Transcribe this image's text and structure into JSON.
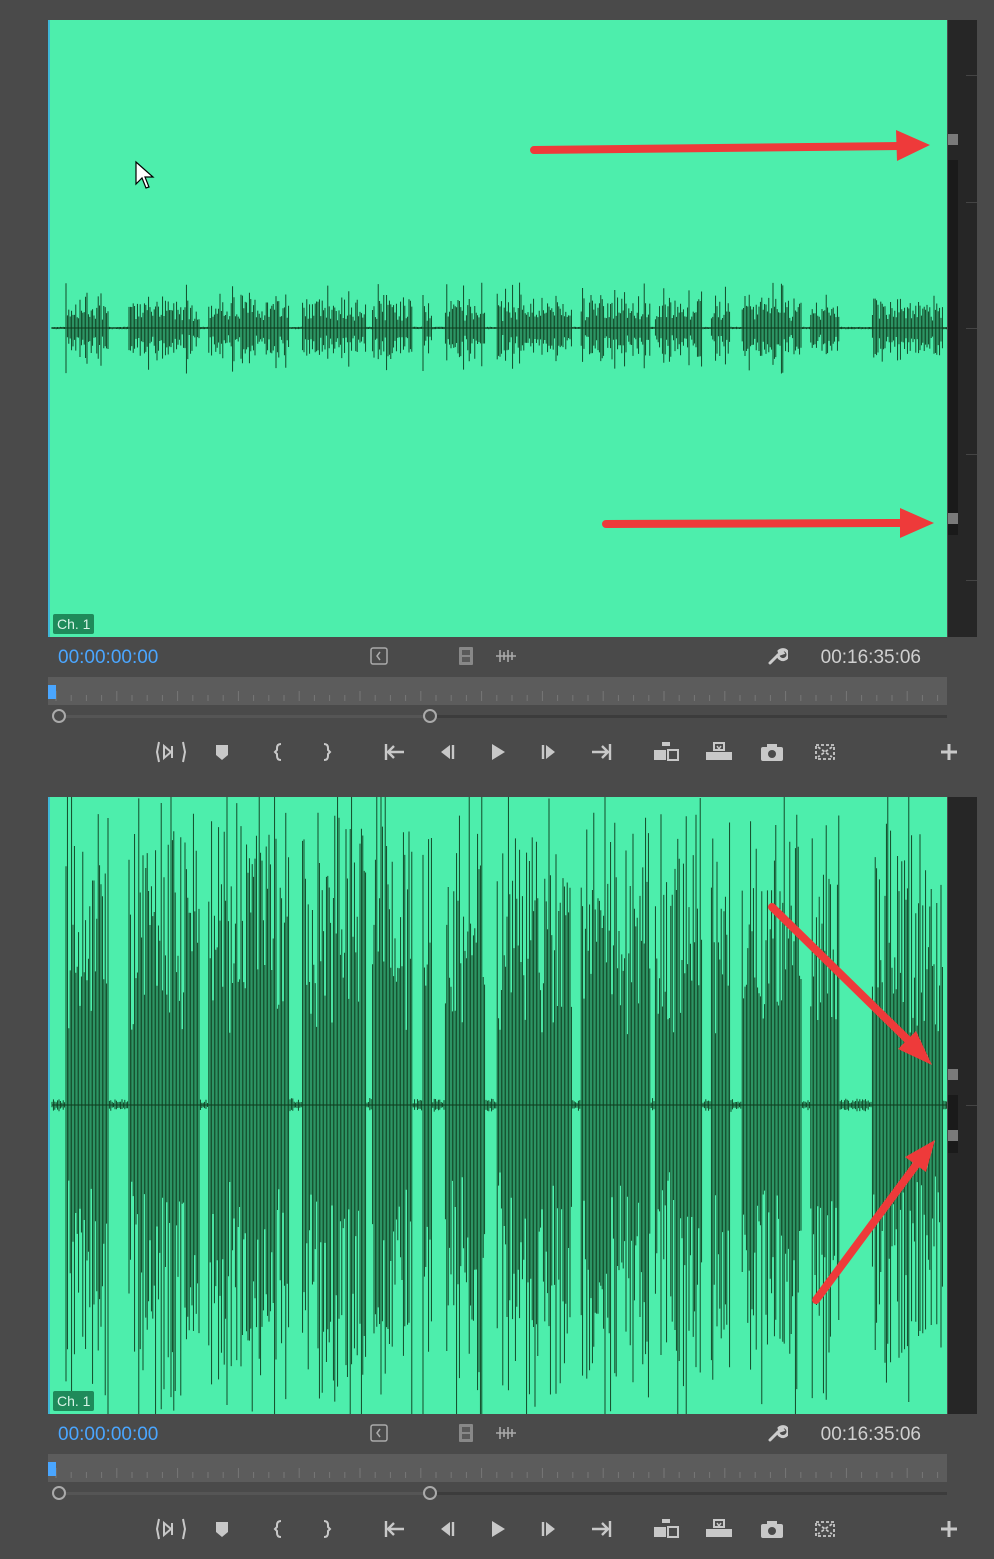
{
  "panels": [
    {
      "id": "top",
      "channel_label": "Ch. 1",
      "timecode_current": "00:00:00:00",
      "timecode_duration": "00:16:35:06"
    },
    {
      "id": "bottom",
      "channel_label": "Ch. 1",
      "timecode_current": "00:00:00:00",
      "timecode_duration": "00:16:35:06"
    }
  ],
  "colors": {
    "waveform_background": "#4deeac",
    "waveform_line": "#0d3a1c",
    "timecode_current": "#4aa6ff",
    "annotation_arrow": "#ee3a3a",
    "app_background": "#4a4a4a"
  },
  "icons": {
    "timebar": [
      "insert-marker-icon",
      "film-icon",
      "audio-scrub-icon",
      "wrench-icon"
    ],
    "transport": [
      "match-frame-icon",
      "add-marker-icon",
      "mark-in-icon",
      "mark-out-icon",
      "go-to-in-icon",
      "step-back-icon",
      "play-icon",
      "step-forward-icon",
      "go-to-out-icon",
      "insert-icon",
      "overwrite-icon",
      "export-frame-icon",
      "button-editor-icon",
      "add-button-icon"
    ]
  },
  "zoom_level_fraction": 0.42
}
